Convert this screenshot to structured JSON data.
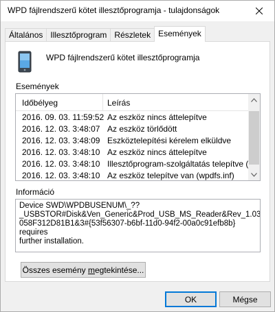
{
  "window": {
    "title": "WPD fájlrendszerű kötet illesztőprogramja - tulajdonságok"
  },
  "tabs": [
    {
      "label": "Általános"
    },
    {
      "label": "Illesztőprogram"
    },
    {
      "label": "Részletek"
    },
    {
      "label": "Események",
      "active": true
    }
  ],
  "device": {
    "name": "WPD fájlrendszerű kötet illesztőprogramja",
    "icon": "portable-device-icon"
  },
  "events": {
    "section_label": "Események",
    "columns": {
      "time": "Időbélyeg",
      "description": "Leírás"
    },
    "rows": [
      {
        "time": "2016. 09. 03. 11:59:52",
        "description": "Az eszköz nincs áttelepítve"
      },
      {
        "time": "2016. 12. 03. 3:48:07",
        "description": "Az eszköz törlődött"
      },
      {
        "time": "2016. 12. 03. 3:48:09",
        "description": "Eszköztelepítési kérelem elküldve"
      },
      {
        "time": "2016. 12. 03. 3:48:10",
        "description": "Az eszköz nincs áttelepítve"
      },
      {
        "time": "2016. 12. 03. 3:48:10",
        "description": "Illesztőprogram-szolgáltatás telepítve (..."
      },
      {
        "time": "2016. 12. 03. 3:48:10",
        "description": "Az eszköz telepítve van (wpdfs.inf)"
      }
    ]
  },
  "info": {
    "section_label": "Információ",
    "text": "Device SWD\\WPDBUSENUM\\_??\n_USBSTOR#Disk&Ven_Generic&Prod_USB_MS_Reader&Rev_1.03#\n058F312D81B1&3#{53f56307-b6bf-11d0-94f2-00a0c91efb8b} requires\nfurther installation."
  },
  "buttons": {
    "view_all_pre": "Összes esemény ",
    "view_all_u": "m",
    "view_all_post": "egtekintése...",
    "ok": "OK",
    "cancel": "Mégse"
  },
  "colors": {
    "accent": "#0078d7",
    "window_bg": "#f0f0f0",
    "panel_bg": "#ffffff"
  }
}
